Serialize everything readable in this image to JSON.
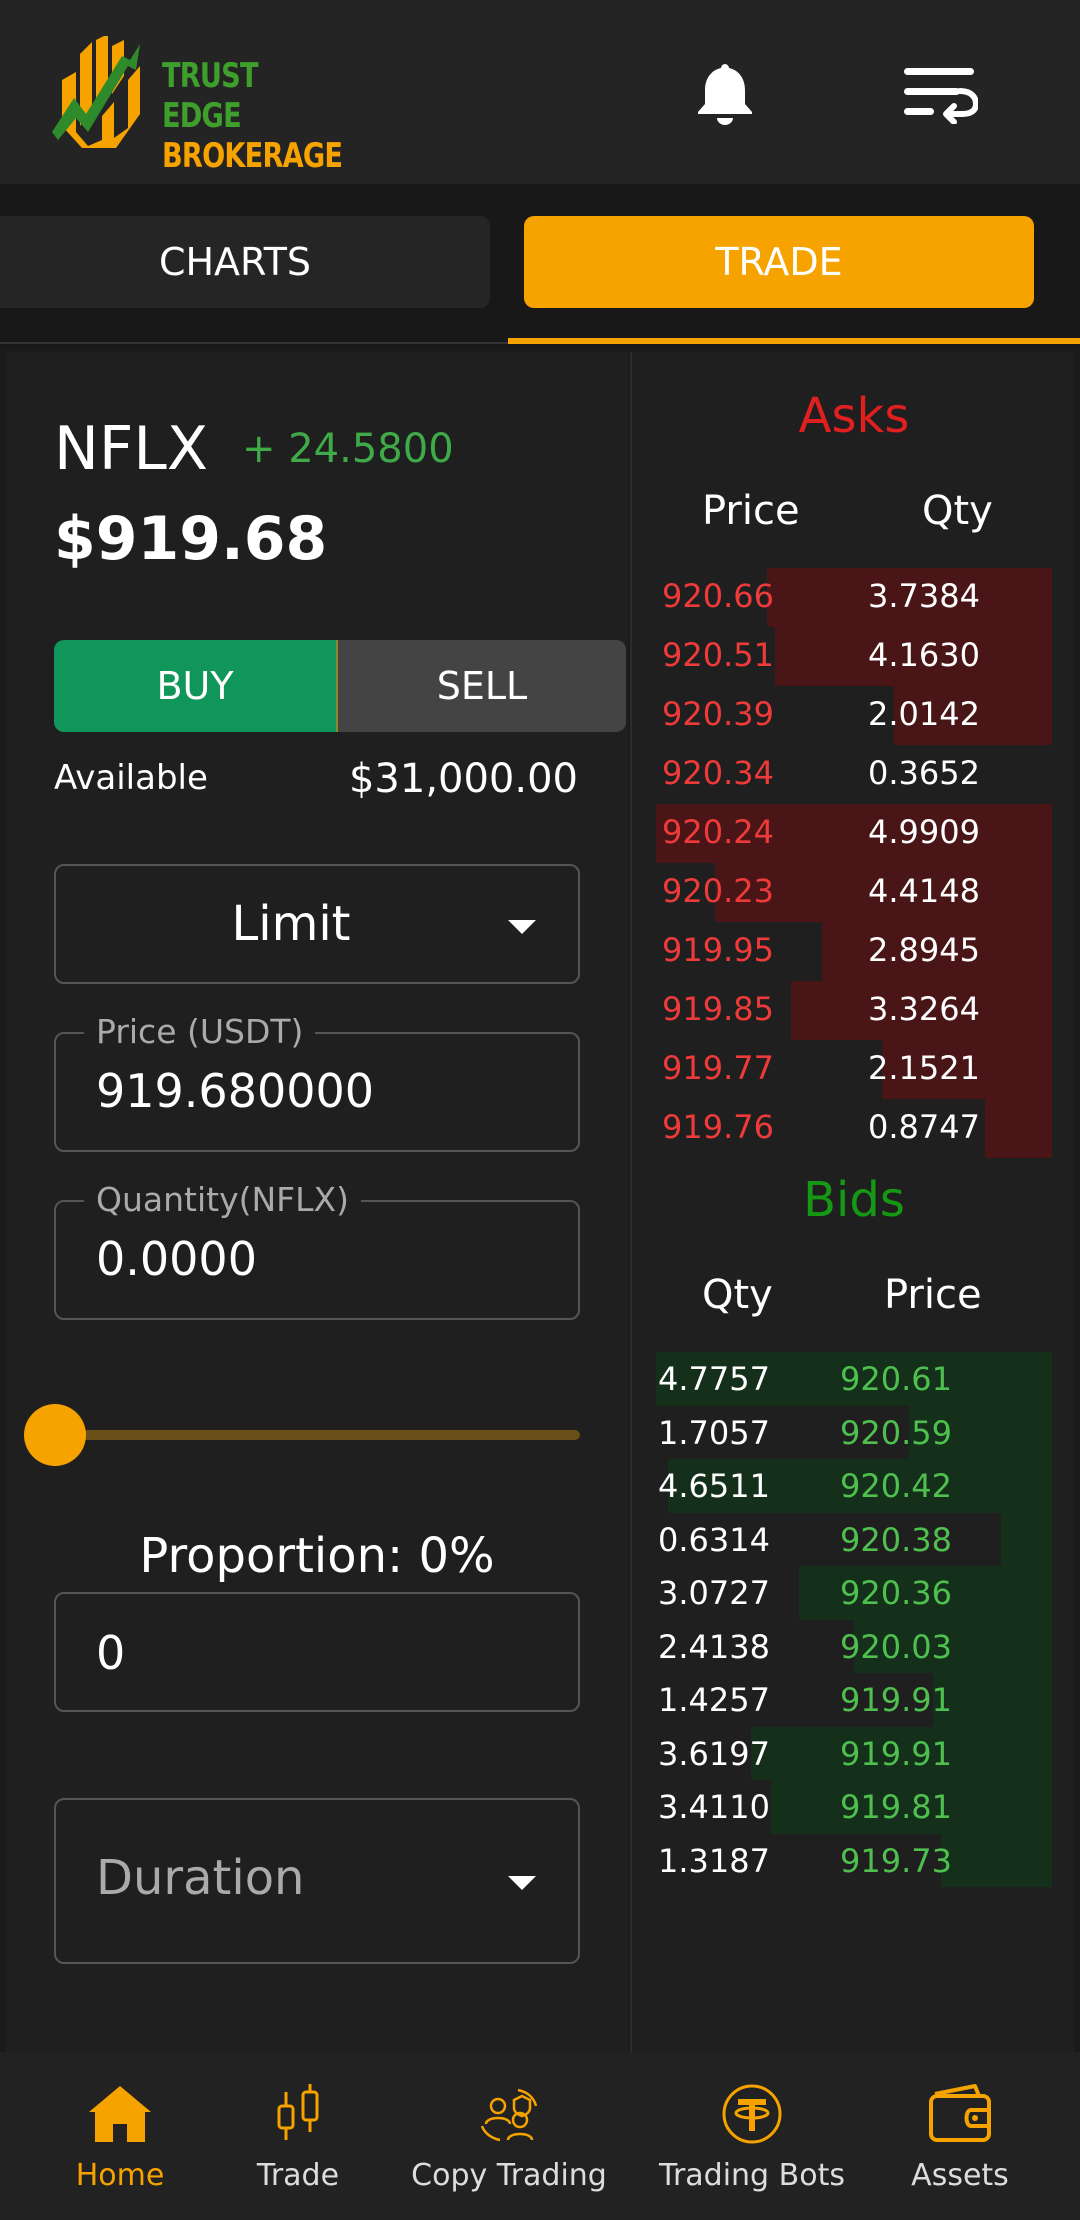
{
  "header": {
    "logo_line1": "TRUST EDGE",
    "logo_line2": "BROKERAGE"
  },
  "tabs": [
    {
      "label": "CHARTS",
      "active": false
    },
    {
      "label": "TRADE",
      "active": true
    }
  ],
  "ticker": {
    "symbol": "NFLX",
    "change": "+ 24.5800",
    "price": "$919.68"
  },
  "order": {
    "buy_label": "BUY",
    "sell_label": "SELL",
    "available_label": "Available",
    "available_value": "$31,000.00",
    "type_value": "Limit",
    "price_label": "Price (USDT)",
    "price_value": "919.680000",
    "qty_label": "Quantity(NFLX)",
    "qty_value": "0.0000",
    "slider_fraction": 0,
    "proportion_label": "Proportion: 0%",
    "proportion_value": "0",
    "duration_placeholder": "Duration"
  },
  "orderbook": {
    "asks_title": "Asks",
    "asks_headers": [
      "Price",
      "Qty"
    ],
    "asks": [
      {
        "price": "920.66",
        "qty": "3.7384",
        "depth": 0.72
      },
      {
        "price": "920.51",
        "qty": "4.1630",
        "depth": 0.7
      },
      {
        "price": "920.39",
        "qty": "2.0142",
        "depth": 0.4
      },
      {
        "price": "920.34",
        "qty": "0.3652",
        "depth": 0.0
      },
      {
        "price": "920.24",
        "qty": "4.9909",
        "depth": 1.0
      },
      {
        "price": "920.23",
        "qty": "4.4148",
        "depth": 0.85
      },
      {
        "price": "919.95",
        "qty": "2.8945",
        "depth": 0.58
      },
      {
        "price": "919.85",
        "qty": "3.3264",
        "depth": 0.66
      },
      {
        "price": "919.77",
        "qty": "2.1521",
        "depth": 0.43
      },
      {
        "price": "919.76",
        "qty": "0.8747",
        "depth": 0.17
      }
    ],
    "asks_color": "#ef3a3a",
    "ask_bar_color": "#4a1517",
    "bids_title": "Bids",
    "bids_headers": [
      "Qty",
      "Price"
    ],
    "bids": [
      {
        "qty": "4.7757",
        "price": "920.61",
        "depth": 1.0
      },
      {
        "qty": "1.7057",
        "price": "920.59",
        "depth": 0.36
      },
      {
        "qty": "4.6511",
        "price": "920.42",
        "depth": 0.97
      },
      {
        "qty": "0.6314",
        "price": "920.38",
        "depth": 0.13
      },
      {
        "qty": "3.0727",
        "price": "920.36",
        "depth": 0.64
      },
      {
        "qty": "2.4138",
        "price": "920.03",
        "depth": 0.5
      },
      {
        "qty": "1.4257",
        "price": "919.91",
        "depth": 0.3
      },
      {
        "qty": "3.6197",
        "price": "919.91",
        "depth": 0.76
      },
      {
        "qty": "3.4110",
        "price": "919.81",
        "depth": 0.71
      },
      {
        "qty": "1.3187",
        "price": "919.73",
        "depth": 0.28
      }
    ],
    "bid_bar_color": "#14301a"
  },
  "nav": [
    {
      "label": "Home",
      "icon": "home-icon",
      "active": true
    },
    {
      "label": "Trade",
      "icon": "candlestick-icon",
      "active": false
    },
    {
      "label": "Copy Trading",
      "icon": "copy-trading-icon",
      "active": false
    },
    {
      "label": "Trading Bots",
      "icon": "tether-coin-icon",
      "active": false
    },
    {
      "label": "Assets",
      "icon": "wallet-icon",
      "active": false
    }
  ],
  "colors": {
    "accent": "#f6a300",
    "buy": "#10965a",
    "up": "#3faa48",
    "down": "#e01f1f"
  }
}
